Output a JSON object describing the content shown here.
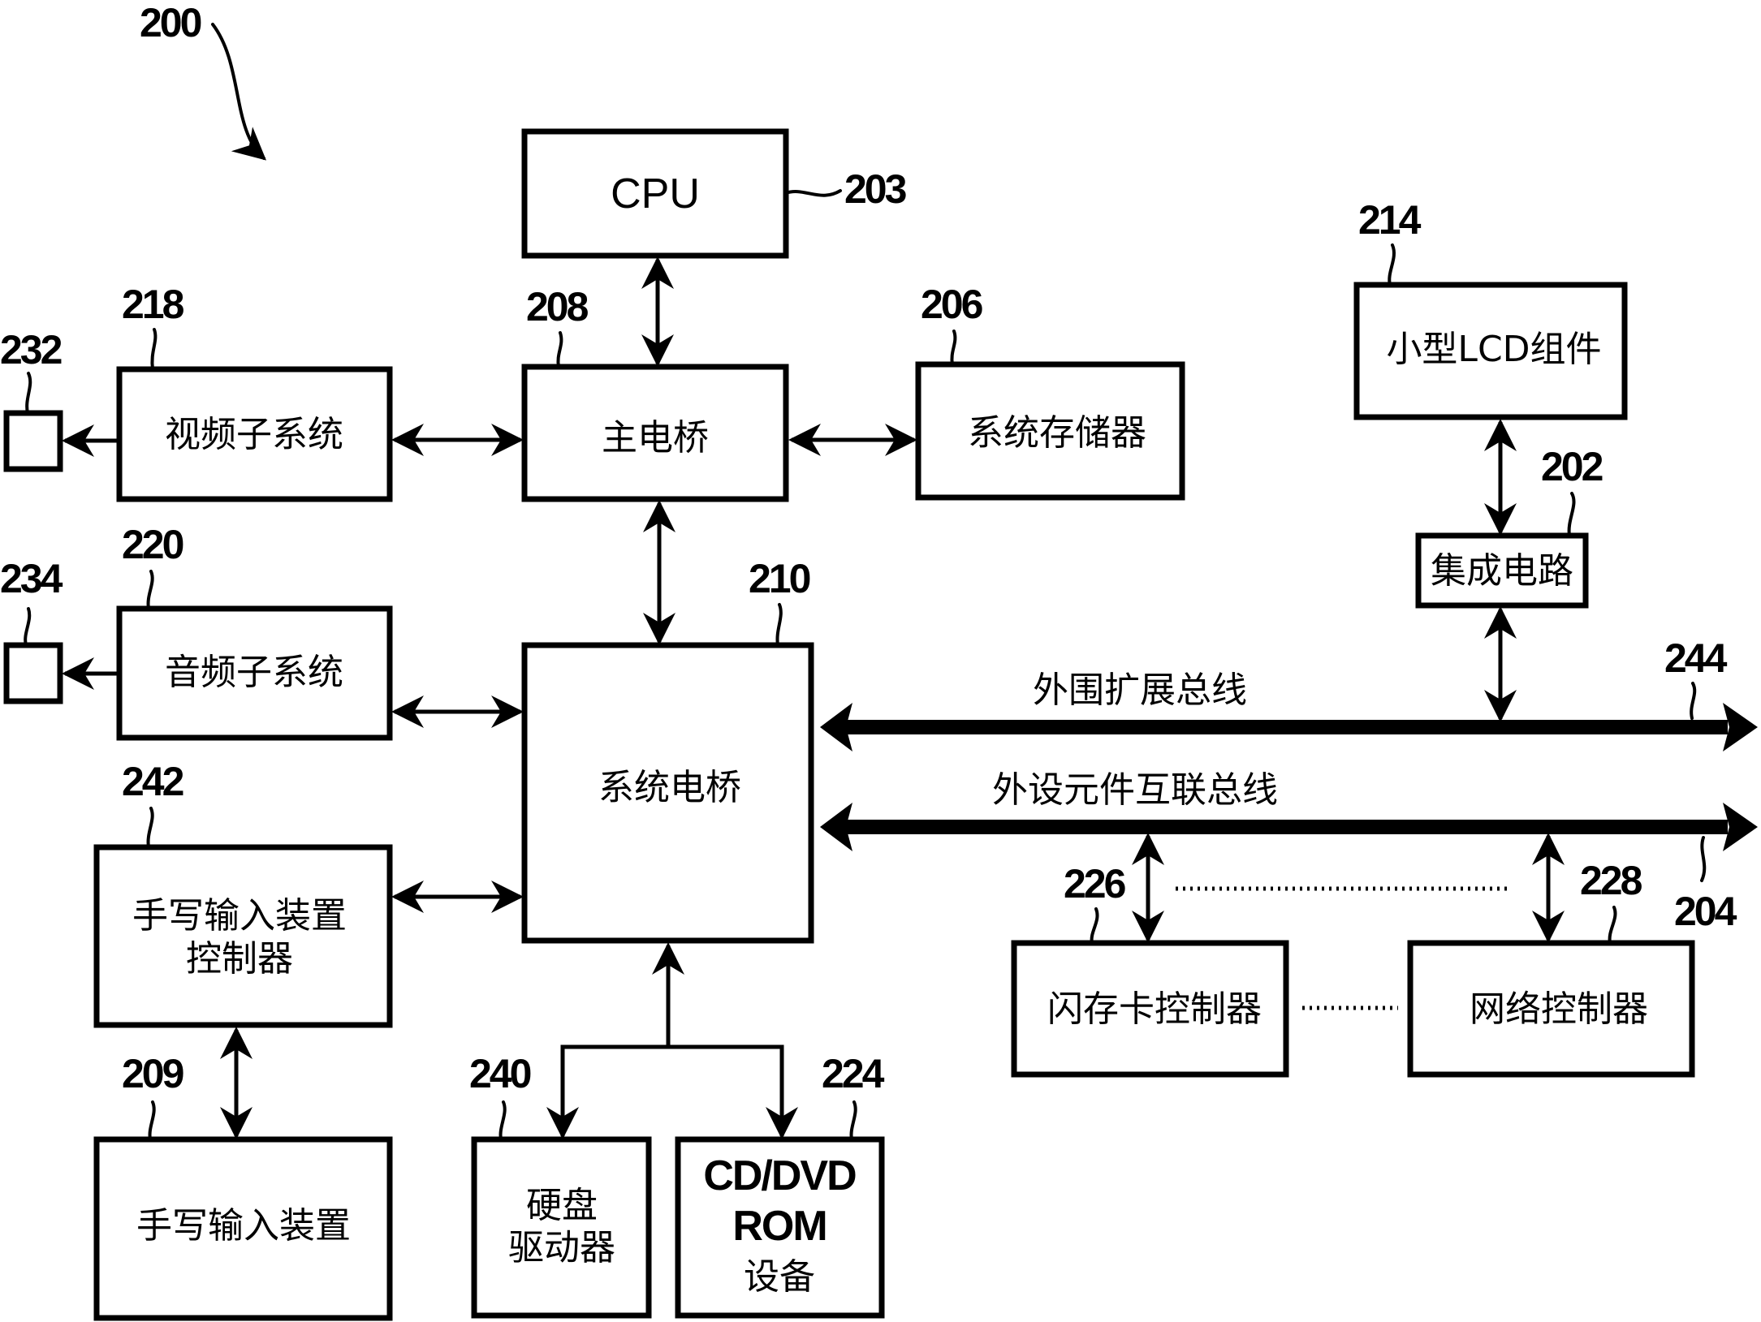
{
  "figure": {
    "ref": "200"
  },
  "blocks": {
    "cpu": {
      "label": "CPU",
      "ref": "203"
    },
    "main_bridge": {
      "label": "主电桥",
      "ref": "208"
    },
    "system_memory": {
      "label": "系统存储器",
      "ref": "206"
    },
    "video_subsystem": {
      "label": "视频子系统",
      "ref": "218"
    },
    "video_out": {
      "ref": "232"
    },
    "audio_subsystem": {
      "label": "音频子系统",
      "ref": "220"
    },
    "audio_out": {
      "ref": "234"
    },
    "system_bridge": {
      "label": "系统电桥",
      "ref": "210"
    },
    "handwriting_controller": {
      "label_line1": "手写输入装置",
      "label_line2": "控制器",
      "ref": "242"
    },
    "handwriting_device": {
      "label": "手写输入装置",
      "ref": "209"
    },
    "hard_disk": {
      "label_line1": "硬盘",
      "label_line2": "驱动器",
      "ref": "240"
    },
    "cd_dvd": {
      "label_line1": "CD/DVD",
      "label_line2": "ROM",
      "label_line3": "设备",
      "ref": "224"
    },
    "lcd_module": {
      "label": "小型LCD组件",
      "ref": "214"
    },
    "integrated_circuit": {
      "label": "集成电路",
      "ref": "202"
    },
    "flash_controller": {
      "label": "闪存卡控制器",
      "ref": "226"
    },
    "network_controller": {
      "label": "网络控制器",
      "ref": "228"
    }
  },
  "buses": {
    "peripheral_expansion": {
      "label": "外围扩展总线",
      "ref": "244"
    },
    "pci": {
      "label": "外设元件互联总线",
      "ref": "204"
    }
  }
}
